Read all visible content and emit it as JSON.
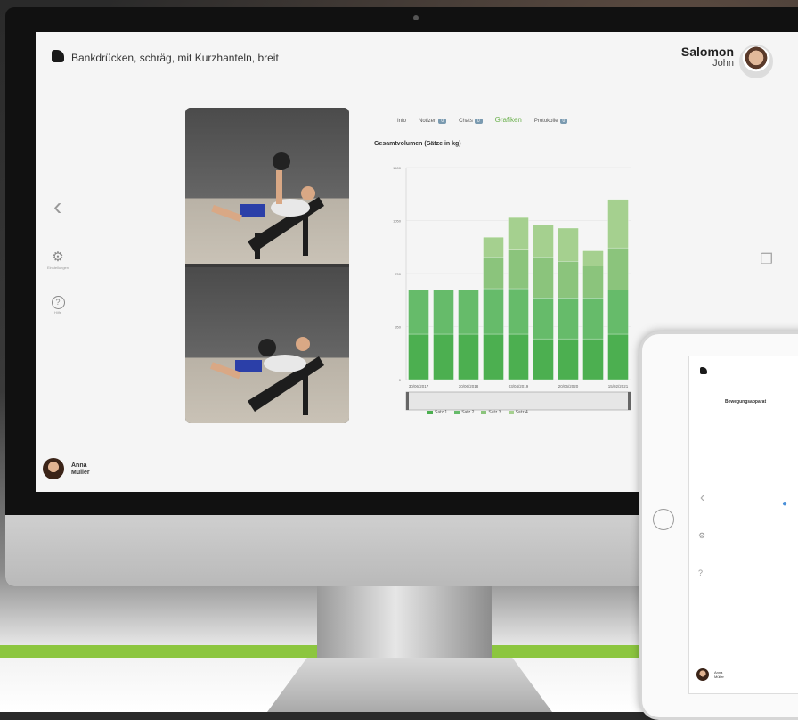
{
  "app": {
    "exercise_title": "Bankdrücken, schräg, mit Kurzhanteln, breit",
    "brand_icon": "logo-icon"
  },
  "user": {
    "first": "Salomon",
    "last": "John"
  },
  "trainer": {
    "first": "Anna",
    "last": "Müller"
  },
  "sidebar": {
    "prev_glyph": "‹",
    "items": [
      {
        "icon": "settings-icon",
        "glyph": "⚙",
        "label": "Einstellungen"
      },
      {
        "icon": "help-icon",
        "glyph": "?",
        "label": "Hilfe"
      }
    ]
  },
  "tabs": [
    {
      "label": "Info",
      "badge": ""
    },
    {
      "label": "Notizen",
      "badge": "0"
    },
    {
      "label": "Chats",
      "badge": "0"
    },
    {
      "label": "Grafiken",
      "badge": "",
      "active": true
    },
    {
      "label": "Protokolle",
      "badge": "0"
    }
  ],
  "chart_data": {
    "type": "bar",
    "stacked": true,
    "title": "Gesamtvolumen (Sätze in kg)",
    "categories": [
      "30/06/2017",
      "30/06/2018",
      "03/04/2019",
      "20/06/2020",
      "15/02/2021"
    ],
    "xlabels_positions": [
      0,
      2,
      4,
      6,
      8
    ],
    "bar_count": 9,
    "ylim": [
      0,
      1400
    ],
    "yticks": [
      0,
      350,
      700,
      1050,
      1400
    ],
    "ytick_labels": [
      "0",
      "350",
      "700",
      "1050",
      "1400"
    ],
    "series": [
      {
        "name": "Satz 1",
        "color": "#4caf50",
        "values": [
          300,
          300,
          300,
          300,
          300,
          270,
          270,
          270,
          300
        ]
      },
      {
        "name": "Satz 2",
        "color": "#66bb6a",
        "values": [
          290,
          290,
          290,
          300,
          300,
          270,
          270,
          270,
          290
        ]
      },
      {
        "name": "Satz 3",
        "color": "#8bc47c",
        "values": [
          0,
          0,
          0,
          210,
          260,
          270,
          240,
          210,
          280
        ]
      },
      {
        "name": "Satz 4",
        "color": "#a5d08f",
        "values": [
          0,
          0,
          0,
          130,
          210,
          210,
          220,
          100,
          320
        ]
      }
    ],
    "grid": true,
    "legend_position": "bottom"
  },
  "tablet": {
    "title": "Bewegungsapparat"
  }
}
